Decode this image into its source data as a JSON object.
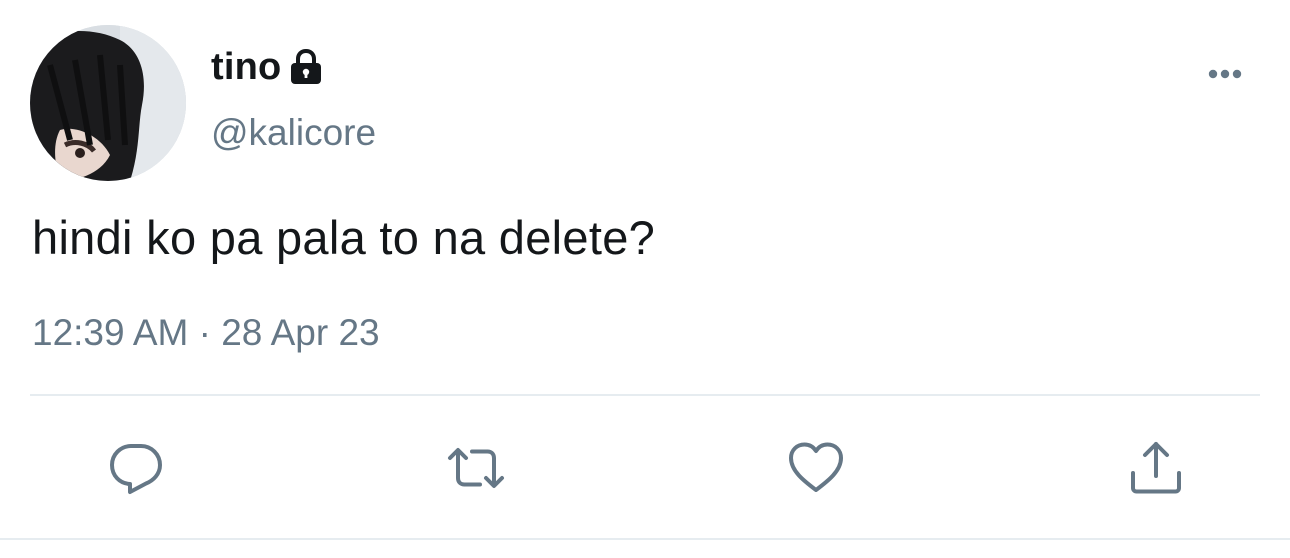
{
  "tweet": {
    "display_name": "tino",
    "handle": "@kalicore",
    "text": "hindi ko pa pala to na delete?",
    "timestamp": "12:39 AM · 28 Apr 23",
    "protected": true
  },
  "icons": {
    "lock": "lock-icon",
    "more": "more-horizontal-icon",
    "reply": "reply-icon",
    "retweet": "retweet-icon",
    "like": "heart-icon",
    "share": "share-icon"
  },
  "colors": {
    "text_primary": "#14171a",
    "text_secondary": "#657786",
    "icon": "#657786",
    "divider": "#e6ecf0"
  }
}
